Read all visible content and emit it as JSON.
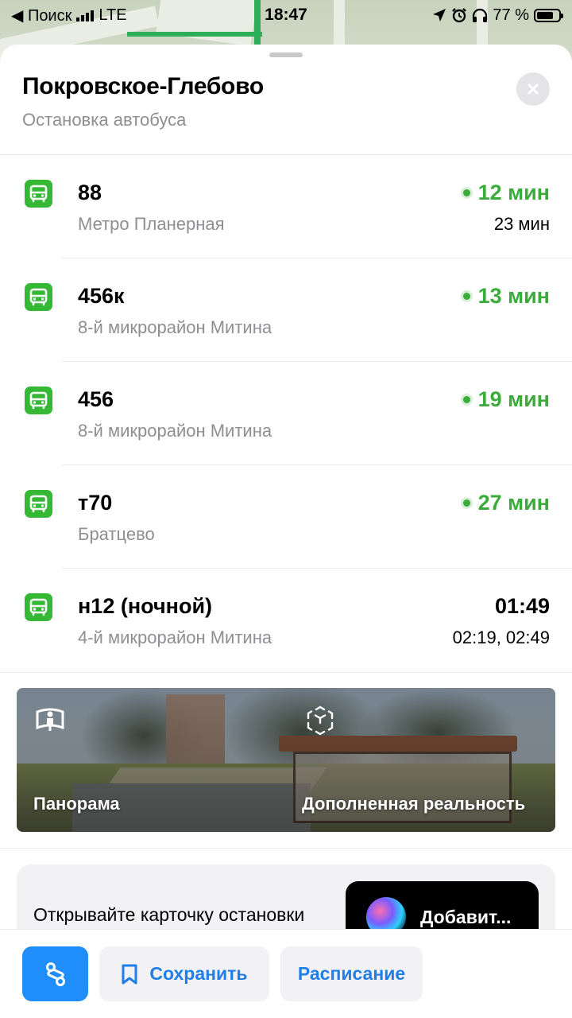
{
  "status_bar": {
    "back_label": "◀ Поиск",
    "network": "LTE",
    "time": "18:47",
    "battery": "77 %",
    "battery_level": 0.77
  },
  "stop": {
    "title": "Покровское-Глебово",
    "subtitle": "Остановка автобуса"
  },
  "routes": [
    {
      "number": "88",
      "destination": "Метро Планерная",
      "time": "12 мин",
      "live": true,
      "next": "23 мин"
    },
    {
      "number": "456к",
      "destination": "8-й микрорайон Митина",
      "time": "13 мин",
      "live": true,
      "next": ""
    },
    {
      "number": "456",
      "destination": "8-й микрорайон Митина",
      "time": "19 мин",
      "live": true,
      "next": ""
    },
    {
      "number": "т70",
      "destination": "Братцево",
      "time": "27 мин",
      "live": true,
      "next": ""
    },
    {
      "number": "н12 (ночной)",
      "destination": "4-й микрорайон Митина",
      "time": "01:49",
      "live": false,
      "next": "02:19, 02:49"
    }
  ],
  "panorama": {
    "panorama_label": "Панорама",
    "ar_label": "Дополненная реальность"
  },
  "promo": {
    "text": "Открывайте карточку остановки",
    "siri_label": "Добавит..."
  },
  "toolbar": {
    "save_label": "Сохранить",
    "schedule_label": "Расписание"
  },
  "colors": {
    "live_green": "#3aac3a",
    "bus_icon_green": "#35b935",
    "accent_blue": "#1f8efa"
  }
}
